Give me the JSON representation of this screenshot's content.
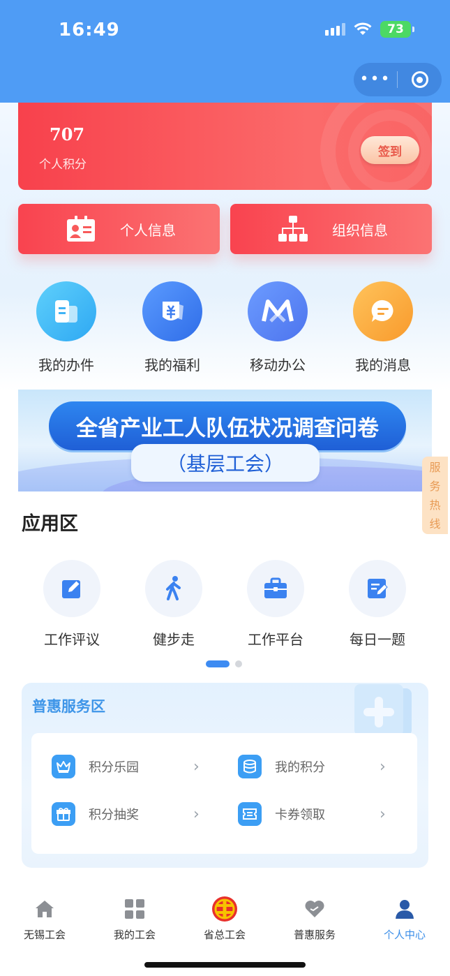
{
  "status_bar": {
    "time": "16:49",
    "battery": "73"
  },
  "points_card": {
    "value": "707",
    "label": "个人积分",
    "signin_label": "签到"
  },
  "info_buttons": {
    "personal": "个人信息",
    "organization": "组织信息"
  },
  "quick_actions": [
    {
      "label": "我的办件",
      "icon": "document-icon"
    },
    {
      "label": "我的福利",
      "icon": "yen-gift-icon"
    },
    {
      "label": "移动办公",
      "icon": "m-logo-icon"
    },
    {
      "label": "我的消息",
      "icon": "message-icon"
    }
  ],
  "banner": {
    "title": "全省产业工人队伍状况调查问卷",
    "subtitle": "（基层工会）"
  },
  "hotline": [
    "服",
    "务",
    "热",
    "线"
  ],
  "app_area": {
    "title": "应用区",
    "items": [
      {
        "label": "工作评议",
        "icon": "edit-icon"
      },
      {
        "label": "健步走",
        "icon": "walk-icon"
      },
      {
        "label": "工作平台",
        "icon": "briefcase-icon"
      },
      {
        "label": "每日一题",
        "icon": "quiz-icon"
      }
    ],
    "page_index": 1,
    "page_count": 2
  },
  "service_area": {
    "title": "普惠服务区",
    "items": [
      {
        "label": "积分乐园",
        "icon": "crown-icon"
      },
      {
        "label": "我的积分",
        "icon": "coins-icon"
      },
      {
        "label": "积分抽奖",
        "icon": "gift-icon"
      },
      {
        "label": "卡券领取",
        "icon": "ticket-icon"
      }
    ]
  },
  "tab_bar": {
    "tabs": [
      {
        "label": "无锡工会",
        "icon": "home-icon"
      },
      {
        "label": "我的工会",
        "icon": "grid-icon"
      },
      {
        "label": "省总工会",
        "icon": "union-emblem-icon"
      },
      {
        "label": "普惠服务",
        "icon": "heart-icon"
      },
      {
        "label": "个人中心",
        "icon": "person-icon"
      }
    ],
    "active": "个人中心"
  },
  "colors": {
    "header_blue": "#4f9cf5",
    "card_red": "#f8414c",
    "accent_blue": "#3b8ee8"
  }
}
